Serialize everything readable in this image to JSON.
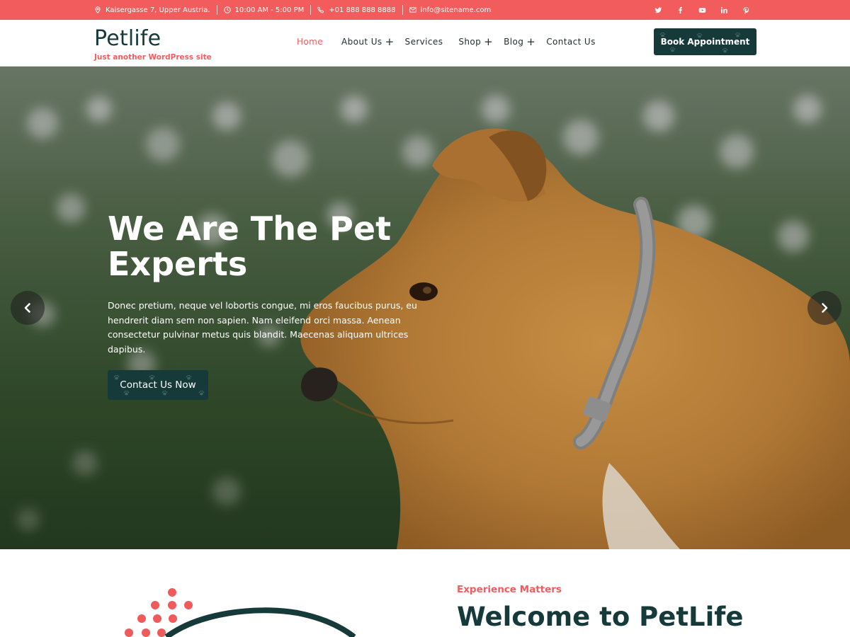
{
  "topbar": {
    "address": "Kaisergasse 7, Upper Austria.",
    "hours": "10:00 AM - 5:00 PM",
    "phone": "+01 888 888 8888",
    "email": "info@sitename.com",
    "socials": [
      "twitter-icon",
      "facebook-icon",
      "youtube-icon",
      "linkedin-icon",
      "pinterest-icon"
    ]
  },
  "header": {
    "site_title": "Petlife",
    "tagline": "Just another WordPress site",
    "nav": [
      {
        "label": "Home",
        "active": true,
        "has_submenu": false
      },
      {
        "label": "About Us",
        "active": false,
        "has_submenu": true
      },
      {
        "label": "Services",
        "active": false,
        "has_submenu": false
      },
      {
        "label": "Shop",
        "active": false,
        "has_submenu": true
      },
      {
        "label": "Blog",
        "active": false,
        "has_submenu": true
      },
      {
        "label": "Contact Us",
        "active": false,
        "has_submenu": false
      }
    ],
    "submenu_symbol": "+",
    "cta_label": "Book Appointment"
  },
  "hero": {
    "title": "We Are The Pet Experts",
    "text": "Donec pretium, neque vel lobortis congue, mi eros faucibus purus, eu hendrerit diam sem non sapien. Nam eleifend orci massa. Aenean consectetur pulvinar metus quis blandit. Maecenas aliquam ultrices dapibus.",
    "button_label": "Contact Us Now"
  },
  "about": {
    "kicker": "Experience Matters",
    "heading": "Welcome to PetLife"
  },
  "colors": {
    "accent": "#f25c5c",
    "primary_dark": "#163a3a",
    "white": "#ffffff"
  }
}
